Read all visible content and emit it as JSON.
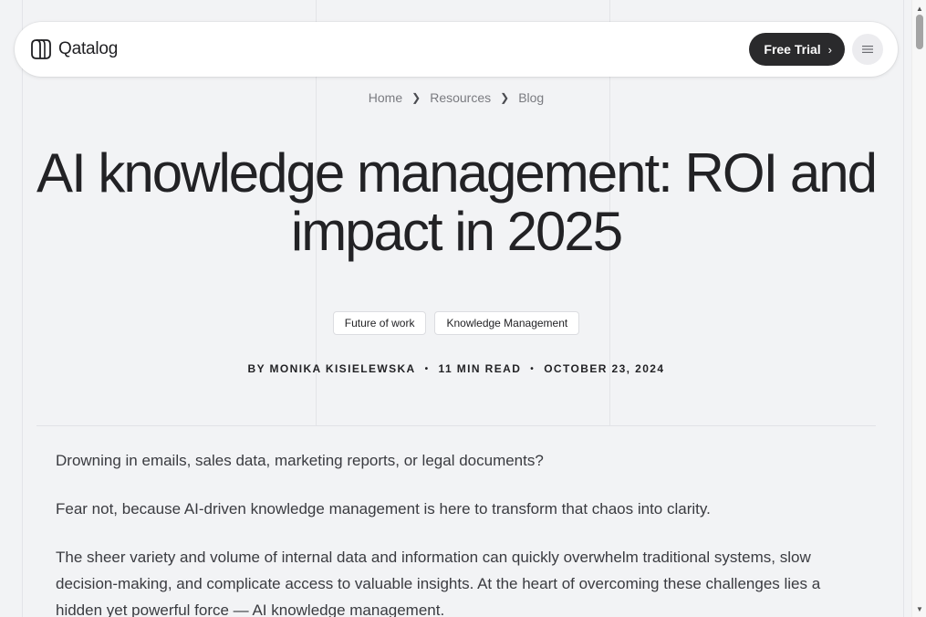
{
  "header": {
    "brand": "Qatalog",
    "trial_label": "Free Trial"
  },
  "breadcrumb": [
    "Home",
    "Resources",
    "Blog"
  ],
  "article": {
    "title": "AI knowledge management: ROI and impact in 2025",
    "tags": [
      "Future of work",
      "Knowledge Management"
    ],
    "author": "BY MONIKA KISIELEWSKA",
    "read_time": "11 MIN READ",
    "date": "OCTOBER 23, 2024",
    "paragraphs": [
      "Drowning in emails, sales data, marketing reports, or legal documents?",
      "Fear not, because AI-driven knowledge management is here to transform that chaos into clarity.",
      "The sheer variety and volume of internal data and information can quickly overwhelm traditional systems, slow decision-making, and complicate access to valuable insights. At the heart of overcoming these challenges lies a hidden yet powerful force — AI knowledge management."
    ]
  },
  "icons": {
    "logo": "qatalog-logo-icon",
    "trial_arrow": "chevron-right-icon",
    "menu": "hamburger-menu-icon",
    "breadcrumb_separator": "chevron-right-icon"
  },
  "colors": {
    "background": "#f2f3f5",
    "button_dark": "#2a2a2c",
    "text": "#222225"
  }
}
